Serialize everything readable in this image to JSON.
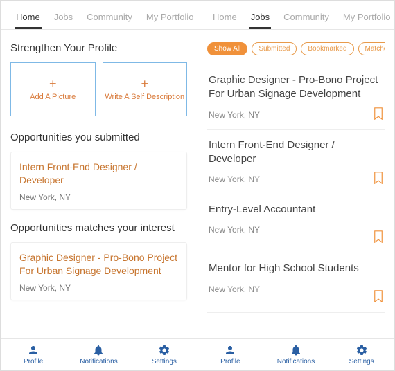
{
  "topnav": {
    "tabs": [
      "Home",
      "Jobs",
      "Community",
      "My Portfolio"
    ]
  },
  "left": {
    "strengthen_title": "Strengthen Your Profile",
    "add_picture": "Add A Picture",
    "add_desc": "Write A Self Description",
    "submitted_title": "Opportunities you submitted",
    "submitted": {
      "title": "Intern Front-End Designer / Developer",
      "location": "New York, NY"
    },
    "matches_title": "Opportunities matches your interest",
    "match": {
      "title": "Graphic Designer - Pro-Bono Project For Urban Signage Development",
      "location": "New York, NY"
    }
  },
  "right": {
    "chips": {
      "show_all": "Show All",
      "submitted": "Submitted",
      "bookmarked": "Bookmarked",
      "matched": "Matched Your Interest"
    },
    "jobs": [
      {
        "title": "Graphic Designer - Pro-Bono Project For Urban Signage Development",
        "location": "New York, NY"
      },
      {
        "title": "Intern Front-End Designer / Developer",
        "location": "New York, NY"
      },
      {
        "title": "Entry-Level Accountant",
        "location": "New York, NY"
      },
      {
        "title": "Mentor for High School Students",
        "location": "New York, NY"
      }
    ]
  },
  "bottomnav": {
    "profile": "Profile",
    "notifications": "Notifications",
    "settings": "Settings"
  }
}
